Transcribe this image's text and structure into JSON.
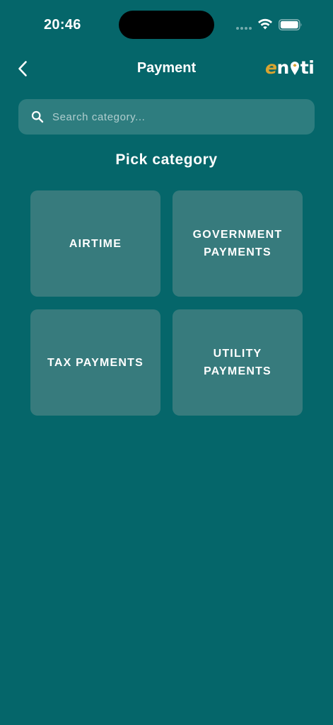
{
  "status_bar": {
    "time": "20:46"
  },
  "nav": {
    "title": "Payment",
    "back_icon": "chevron-left-icon",
    "logo": {
      "part_e": "e",
      "part_n": "n",
      "part_ti": "ti"
    }
  },
  "search": {
    "placeholder": "Search category...",
    "value": ""
  },
  "section_title": "Pick category",
  "categories": [
    {
      "label": "AIRTIME"
    },
    {
      "label": "GOVERNMENT\nPAYMENTS"
    },
    {
      "label": "TAX PAYMENTS"
    },
    {
      "label": "UTILITY\nPAYMENTS"
    }
  ],
  "colors": {
    "background": "#05666a",
    "card": "#377b7d",
    "search_bg": "#2e7d7f",
    "logo_accent": "#d8a431"
  }
}
